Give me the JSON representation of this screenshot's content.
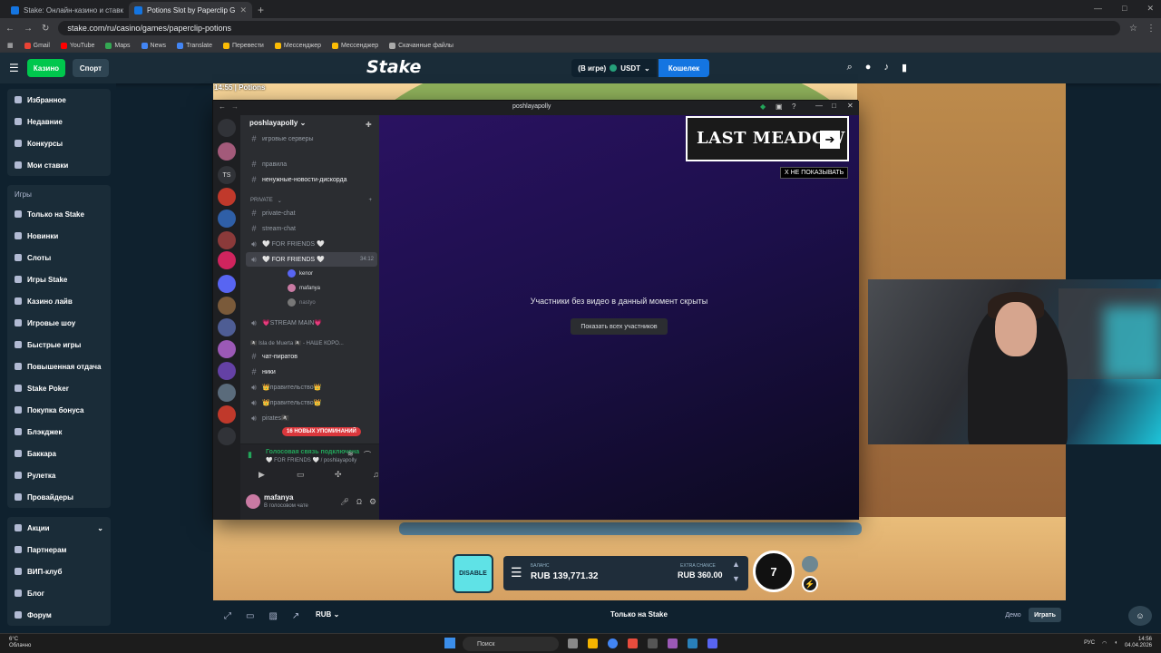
{
  "browser": {
    "tabs": [
      {
        "label": "Stake: Онлайн-казино и ставк"
      },
      {
        "label": "Potions Slot by Paperclip G"
      }
    ],
    "url": "stake.com/ru/casino/games/paperclip-potions",
    "bookmarks": [
      "Gmail",
      "YouTube",
      "Maps",
      "News",
      "Translate",
      "Перевести",
      "Мессенджер",
      "Мессенджер",
      "Скачанные файлы"
    ]
  },
  "stake": {
    "casino_label": "Казино",
    "sport_label": "Спорт",
    "logo": "Stake",
    "balance_label": "(В игре)",
    "currency": "USDT",
    "wallet_label": "Кошелек",
    "sidebar": {
      "top": [
        "Избранное",
        "Недавние",
        "Конкурсы",
        "Мои ставки"
      ],
      "games_heading": "Игры",
      "games": [
        "Только на Stake",
        "Новинки",
        "Слоты",
        "Игры Stake",
        "Казино лайв",
        "Игровые шоу",
        "Быстрые игры",
        "Повышенная отдача",
        "Stake Poker",
        "Покупка бонуса",
        "Блэкджек",
        "Баккара",
        "Рулетка",
        "Провайдеры"
      ],
      "bottom": [
        "Акции",
        "Партнерам",
        "ВИП-клуб",
        "Блог",
        "Форум"
      ]
    }
  },
  "game": {
    "title": "14:55 | Potions",
    "disable_label": "DISABLE",
    "balance_label": "БАЛАНС",
    "balance_value": "RUB 139,771.32",
    "extra_chance_label": "EXTRA CHANCE",
    "extra_chance_value": "RUB 360.00",
    "spin_count": "7",
    "currency_selector": "RUB",
    "only_on": "Только на Stake",
    "demo_label": "Демо",
    "play_label": "Играть"
  },
  "discord": {
    "window_title": "poshlayapolly",
    "server_name": "poshlayapolly",
    "channels": [
      {
        "name": "игровые серверы",
        "type": "text"
      },
      {
        "name": "правила",
        "type": "text"
      },
      {
        "name": "ненужные-новости-дискорда",
        "type": "text"
      },
      {
        "name": "PRIVATE",
        "type": "category"
      },
      {
        "name": "private-chat",
        "type": "text"
      },
      {
        "name": "stream-chat",
        "type": "text"
      },
      {
        "name": "🤍 FOR FRIENDS 🤍",
        "type": "voice"
      },
      {
        "name": "🤍 FOR FRIENDS 🤍",
        "type": "voice",
        "selected": true,
        "time": "34:12"
      }
    ],
    "members": [
      "kenor",
      "mafanya",
      "nastyo"
    ],
    "channels2": [
      {
        "name": "💗STREAM MAIN💗",
        "type": "voice"
      },
      {
        "name": "🏴‍☠️ Isla de Muerta 🏴‍☠️ - НАШЕ КОРО...",
        "type": "category"
      },
      {
        "name": "чат-пиратов",
        "type": "text"
      },
      {
        "name": "ники",
        "type": "text"
      },
      {
        "name": "👑правительство👑",
        "type": "voice"
      },
      {
        "name": "👑правительство👑",
        "type": "voice"
      },
      {
        "name": "pirates🏴‍☠️",
        "type": "voice"
      }
    ],
    "mentions": "16 НОВЫХ УПОМИНАНИЙ",
    "voice_connected": "Голосовая связь подключена",
    "voice_channel": "🤍 FOR FRIENDS 🤍 / poshlayapolly",
    "username": "mafanya",
    "user_status": "В голосовом чате",
    "hidden_text": "Участники без видео в данный момент скрыты",
    "show_all": "Показать всех участников"
  },
  "ad": {
    "title": "LAST MEADOW",
    "dismiss": "X НЕ ПОКАЗЫВАТЬ"
  },
  "taskbar": {
    "weather_temp": "6°C",
    "weather_desc": "Облачно",
    "search": "Поиск",
    "lang": "РУС",
    "time": "14:56",
    "date": "04.04.2026"
  }
}
